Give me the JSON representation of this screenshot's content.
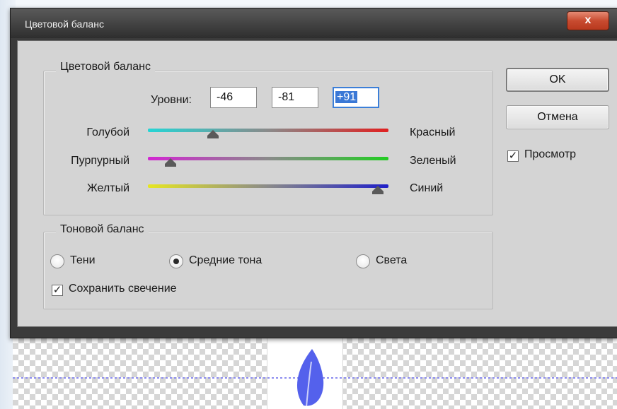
{
  "dialog": {
    "title": "Цветовой баланс",
    "close_label": "x"
  },
  "color_balance": {
    "group_title": "Цветовой баланс",
    "levels_label": "Уровни:",
    "levels": [
      "-46",
      "-81",
      "+91"
    ],
    "sliders": [
      {
        "left": "Голубой",
        "right": "Красный",
        "value": -46,
        "colors": [
          "#25d5d5",
          "#e02020"
        ]
      },
      {
        "left": "Пурпурный",
        "right": "Зеленый",
        "value": -81,
        "colors": [
          "#d225d2",
          "#22cc22"
        ]
      },
      {
        "left": "Желтый",
        "right": "Синий",
        "value": 91,
        "colors": [
          "#e6e622",
          "#1f1fc8"
        ]
      }
    ],
    "slider_range": [
      -100,
      100
    ]
  },
  "tone_balance": {
    "group_title": "Тоновой баланс",
    "options": [
      "Тени",
      "Средние тона",
      "Света"
    ],
    "selected": "Средние тона",
    "preserve_label": "Сохранить свечение",
    "preserve_checked": true
  },
  "actions": {
    "ok": "OK",
    "cancel": "Отмена",
    "preview_label": "Просмотр",
    "preview_checked": true
  },
  "colors": {
    "accent": "#3a78d6",
    "leaf": "#5461ec"
  }
}
